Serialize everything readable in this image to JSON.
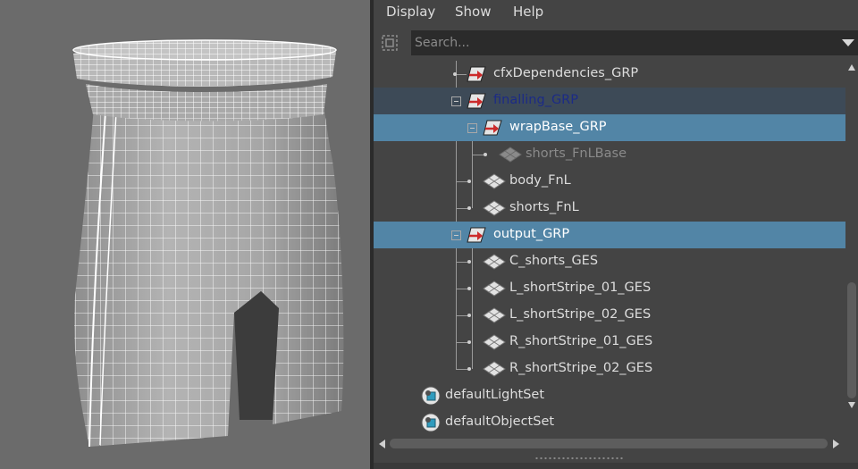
{
  "menu": {
    "items": [
      "Display",
      "Show",
      "Help"
    ]
  },
  "search": {
    "placeholder": "Search..."
  },
  "icons": {
    "filter": "filter-icon",
    "transform_group": "transform-group-icon",
    "mesh": "mesh-icon",
    "set": "object-set-icon"
  },
  "colors": {
    "selected_row": "#5285a6",
    "secondary_selection": "#3d4a57",
    "panel_bg": "#444444",
    "viewport_bg": "#6b6b6b"
  },
  "tree": {
    "rows": [
      {
        "label": "cfxDependencies_GRP",
        "type": "group"
      },
      {
        "label": "finalling_GRP",
        "type": "group",
        "expanded": true
      },
      {
        "label": "wrapBase_GRP",
        "type": "group",
        "expanded": true,
        "selected": true
      },
      {
        "label": "shorts_FnLBase",
        "type": "mesh",
        "dimmed": true
      },
      {
        "label": "body_FnL",
        "type": "mesh"
      },
      {
        "label": "shorts_FnL",
        "type": "mesh"
      },
      {
        "label": "output_GRP",
        "type": "group",
        "expanded": true,
        "selected": true
      },
      {
        "label": "C_shorts_GES",
        "type": "mesh"
      },
      {
        "label": "L_shortStripe_01_GES",
        "type": "mesh"
      },
      {
        "label": "L_shortStripe_02_GES",
        "type": "mesh"
      },
      {
        "label": "R_shortStripe_01_GES",
        "type": "mesh"
      },
      {
        "label": "R_shortStripe_02_GES",
        "type": "mesh"
      },
      {
        "label": "defaultLightSet",
        "type": "set"
      },
      {
        "label": "defaultObjectSet",
        "type": "set"
      }
    ]
  }
}
